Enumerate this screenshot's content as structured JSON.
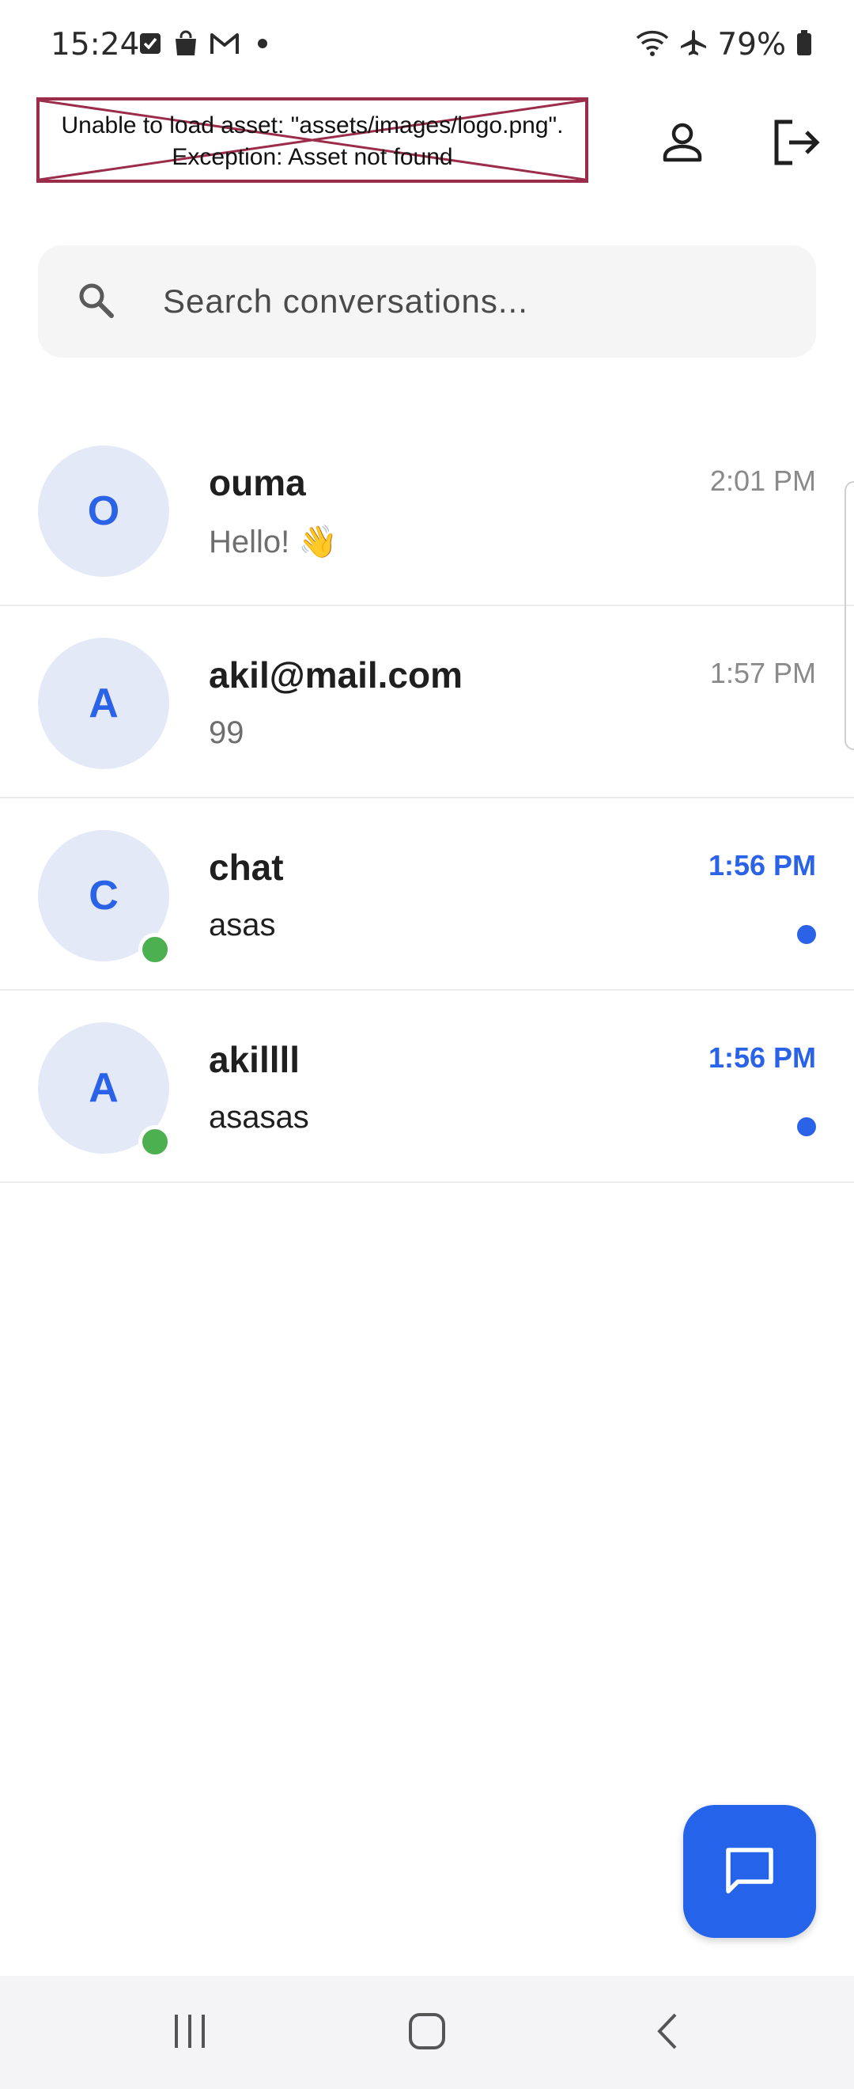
{
  "status_bar": {
    "time": "15:24",
    "battery": "79%",
    "left_icons": [
      "checkbox-icon",
      "shopping-bag-icon",
      "gmail-icon",
      "dot-icon"
    ],
    "right_icons": [
      "wifi-icon",
      "airplane-icon",
      "battery-icon"
    ]
  },
  "header": {
    "logo_error_line1": "Unable to load asset: \"assets/images/logo.png\".",
    "logo_error_line2": "Exception: Asset not found",
    "profile_icon": "person-icon",
    "logout_icon": "logout-icon"
  },
  "search": {
    "placeholder": "Search conversations..."
  },
  "conversations": [
    {
      "initial": "O",
      "name": "ouma",
      "time": "2:01 PM",
      "message": "Hello! 👋",
      "unread": false,
      "online": false
    },
    {
      "initial": "A",
      "name": "akil@mail.com",
      "time": "1:57 PM",
      "message": "99",
      "unread": false,
      "online": false
    },
    {
      "initial": "C",
      "name": "chat",
      "time": "1:56 PM",
      "message": "asas",
      "unread": true,
      "online": true
    },
    {
      "initial": "A",
      "name": "akillll",
      "time": "1:56 PM",
      "message": "asasas",
      "unread": true,
      "online": true
    }
  ],
  "colors": {
    "accent": "#2563eb",
    "online": "#4caf50",
    "avatar_bg": "#e4e9f8",
    "error_border": "#9b2d4a"
  },
  "fab": {
    "icon": "chat-bubble-icon"
  },
  "nav_bar": {
    "icons": [
      "recent-apps-icon",
      "home-icon",
      "back-icon"
    ]
  }
}
